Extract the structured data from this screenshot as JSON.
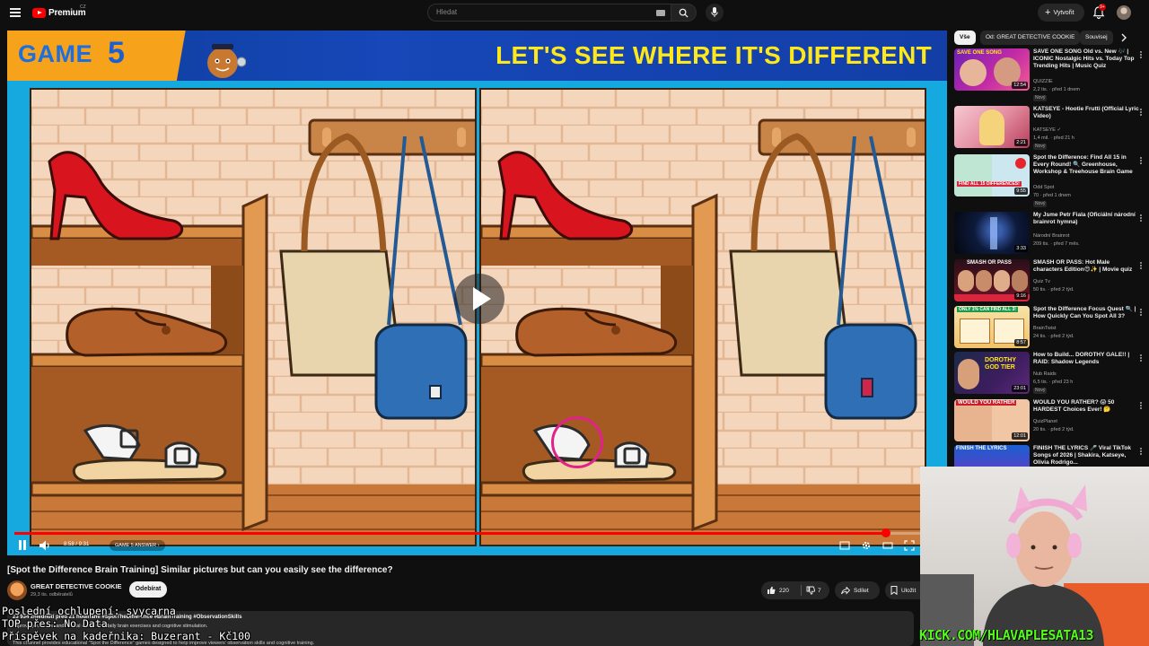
{
  "topbar": {
    "logo_text": "Premium",
    "logo_country": "CZ",
    "search_placeholder": "Hledat",
    "create_label": "Vytvořit",
    "notifications_count": "9+"
  },
  "player": {
    "banner_game": "GAME",
    "banner_number": "5",
    "banner_title": "LET'S SEE WHERE IT'S DIFFERENT",
    "time_display": "8:58 / 9:31",
    "chapter_label": "GAME 5 ANSWER",
    "progress": 0.942
  },
  "video": {
    "title": "[Spot the Difference Brain Training] Similar pictures but can you easily see the difference?",
    "channel": "GREAT DETECTIVE COOKIE",
    "subscribers": "29,3 tis. odběratelů",
    "subscribe_label": "Odebírat",
    "likes": "220",
    "dislikes": "7",
    "share_label": "Sdílet",
    "save_label": "Uložit"
  },
  "description": {
    "meta": "23 934 zhlédnutí  před 21 hodinami  #SpotTheDifference #BrainTraining #ObservationSkills",
    "line1": "Improve your focus and mental clarity with daily brain exercises and cognitive stimulation.",
    "line2": "This channel provides educational \"Spot the Difference\" games designed to help improve viewers' observation skills and cognitive training."
  },
  "overlays": {
    "line1": "Poslední ochlupení: svycarna",
    "line2": "TOP přes: No Data",
    "line3": "Příspěvek na kadeřnika: Buzerant - Kč100",
    "kick": "KICK.COM/HLAVAPLESATA13"
  },
  "sidebar": {
    "chips": [
      "Vše",
      "Od: GREAT DETECTIVE COOKIE",
      "Souvisej"
    ],
    "recommendations": [
      {
        "title": "SAVE ONE SONG  Old vs. New 🎶 | ICONIC Nostalgic Hits vs. Today Top Trending Hits | Music Quiz",
        "channel": "QUIZZIE",
        "stats": "2,2 tis. · před 1 dnem",
        "badge": "Nový",
        "duration": "12:54",
        "thumb_text": "SAVE ONE SONG"
      },
      {
        "title": "KATSEYE - Hootie Frutti (Official Lyric Video)",
        "channel": "KATSEYE ✓",
        "stats": "1,4 mil. · před 21 h",
        "badge": "Nový",
        "duration": "2:21",
        "thumb_text": ""
      },
      {
        "title": "Spot the Difference: Find All 15 in Every Round! 🔍 Greenhouse, Workshop & Treehouse Brain Game",
        "channel": "Odd Spot",
        "stats": "70 · před 1 dnem",
        "badge": "Nový",
        "duration": "9:55",
        "thumb_text": "FIND ALL 15 DIFFERENCES!"
      },
      {
        "title": "My Jsme Petr Fiala (Oficiální národní brainrot hymna)",
        "channel": "Národní Brainrot",
        "stats": "209 tis. · před 7 měs.",
        "badge": "",
        "duration": "3:33",
        "thumb_text": ""
      },
      {
        "title": "SMASH OR PASS: Hot Male characters Edition😍✨ | Movie quiz",
        "channel": "Quiz Tv",
        "stats": "50 tis. · před 2 týd.",
        "badge": "",
        "duration": "9:16",
        "thumb_text": "SMASH OR PASS"
      },
      {
        "title": "Spot the Difference Focus Quest 🔍 | How Quickly Can You Spot All 3?",
        "channel": "BrainTwist",
        "stats": "24 tis. · před 2 týd.",
        "badge": "",
        "duration": "8:57",
        "thumb_text": "ONLY 1% CAN FIND ALL 3!"
      },
      {
        "title": "How to Build... DOROTHY GALE!! | RAID: Shadow Legends",
        "channel": "Nub Raids",
        "stats": "6,5 tis. · před 23 h",
        "badge": "Nový",
        "duration": "23:01",
        "thumb_text": "DOROTHY GOD TIER"
      },
      {
        "title": "WOULD YOU RATHER? 😱 50 HARDEST Choices Ever! 🤔",
        "channel": "QuizPlanet",
        "stats": "20 tis. · před 2 týd.",
        "badge": "",
        "duration": "12:01",
        "thumb_text": "WOULD YOU RATHER"
      },
      {
        "title": "FINISH THE LYRICS 🎤 Viral TikTok Songs of 2026 | Shakira, Katseye, Olivia Rodrigo...",
        "channel": "",
        "stats": "",
        "badge": "",
        "duration": "",
        "thumb_text": "FINISH THE LYRICS"
      }
    ]
  },
  "colors": {
    "accent_red": "#ff0000",
    "banner_yellow": "#ffe81a",
    "kick_green": "#53fc18",
    "circle_pink": "#e0238a"
  }
}
